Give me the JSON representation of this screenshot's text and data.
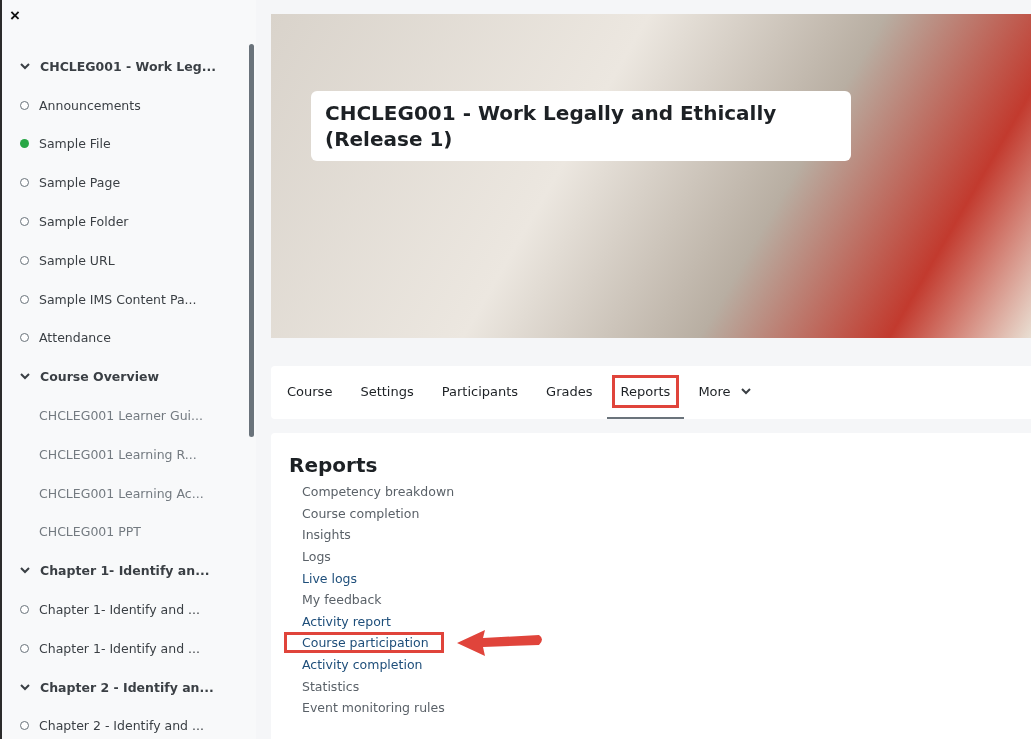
{
  "drawer": {
    "close": "×",
    "sections": [
      {
        "title": "CHCLEG001 - Work Leg...",
        "expanded": true,
        "items": [
          {
            "label": "Announcements",
            "kind": "activity",
            "completed": false,
            "dimmed": false
          },
          {
            "label": "Sample File",
            "kind": "activity",
            "completed": true,
            "dimmed": false
          },
          {
            "label": "Sample Page",
            "kind": "activity",
            "completed": false,
            "dimmed": false
          },
          {
            "label": "Sample Folder",
            "kind": "activity",
            "completed": false,
            "dimmed": false
          },
          {
            "label": "Sample URL",
            "kind": "activity",
            "completed": false,
            "dimmed": false
          },
          {
            "label": "Sample IMS Content Pa...",
            "kind": "activity",
            "completed": false,
            "dimmed": false
          },
          {
            "label": "Attendance",
            "kind": "activity",
            "completed": false,
            "dimmed": false
          }
        ]
      },
      {
        "title": "Course Overview",
        "expanded": true,
        "items": [
          {
            "label": "CHCLEG001 Learner Gui...",
            "kind": "label",
            "dimmed": true
          },
          {
            "label": "CHCLEG001 Learning R...",
            "kind": "label",
            "dimmed": true
          },
          {
            "label": "CHCLEG001 Learning Ac...",
            "kind": "label",
            "dimmed": true
          },
          {
            "label": "CHCLEG001 PPT",
            "kind": "label",
            "dimmed": true
          }
        ]
      },
      {
        "title": "Chapter 1- Identify an...",
        "expanded": true,
        "items": [
          {
            "label": "Chapter 1- Identify and ...",
            "kind": "activity",
            "completed": false,
            "dimmed": false
          },
          {
            "label": "Chapter 1- Identify and ...",
            "kind": "activity",
            "completed": false,
            "dimmed": false
          }
        ]
      },
      {
        "title": "Chapter 2 - Identify an...",
        "expanded": true,
        "items": [
          {
            "label": "Chapter 2 - Identify and ...",
            "kind": "activity",
            "completed": false,
            "dimmed": false
          }
        ]
      }
    ]
  },
  "header": {
    "title": "CHCLEG001 - Work Legally and Ethically (Release 1)"
  },
  "tabs": [
    {
      "label": "Course",
      "selected": false,
      "highlighted": false,
      "dropdown": false
    },
    {
      "label": "Settings",
      "selected": false,
      "highlighted": false,
      "dropdown": false
    },
    {
      "label": "Participants",
      "selected": false,
      "highlighted": false,
      "dropdown": false
    },
    {
      "label": "Grades",
      "selected": false,
      "highlighted": false,
      "dropdown": false
    },
    {
      "label": "Reports",
      "selected": true,
      "highlighted": true,
      "dropdown": false
    },
    {
      "label": "More",
      "selected": false,
      "highlighted": false,
      "dropdown": true
    }
  ],
  "reports": {
    "heading": "Reports",
    "links": [
      {
        "label": "Competency breakdown",
        "visited": true,
        "highlighted": false
      },
      {
        "label": "Course completion",
        "visited": true,
        "highlighted": false
      },
      {
        "label": "Insights",
        "visited": true,
        "highlighted": false
      },
      {
        "label": "Logs",
        "visited": true,
        "highlighted": false
      },
      {
        "label": "Live logs",
        "visited": false,
        "highlighted": false
      },
      {
        "label": "My feedback",
        "visited": true,
        "highlighted": false
      },
      {
        "label": "Activity report",
        "visited": false,
        "highlighted": false
      },
      {
        "label": "Course participation",
        "visited": false,
        "highlighted": true
      },
      {
        "label": "Activity completion",
        "visited": false,
        "highlighted": false
      },
      {
        "label": "Statistics",
        "visited": true,
        "highlighted": false
      },
      {
        "label": "Event monitoring rules",
        "visited": true,
        "highlighted": false
      }
    ]
  }
}
